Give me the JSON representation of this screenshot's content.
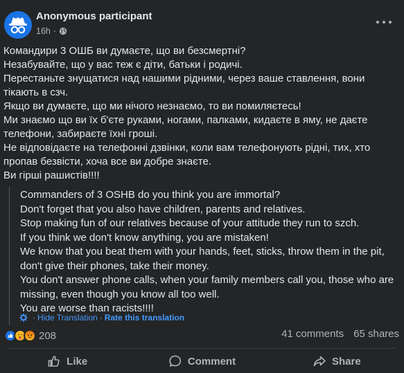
{
  "post": {
    "author": "Anonymous participant",
    "time": "16h",
    "separator": "·",
    "body_lines": [
      "Командири 3 ОШБ ви думаєте, що ви безсмертні?",
      "Незабувайте, що у вас теж є діти, батьки і родичі.",
      "Перестаньте знущатися над нашими рідними, через ваше ставлення, вони",
      "тікають в сзч.",
      "Якщо ви думаєте, що ми нічого незнаємо, то ви помиляєтесь!",
      "Ми знаємо що ви їх б'єте руками, ногами, палками, кидаєте в яму, не даєте",
      "телефони, забираєте їхні гроші.",
      "Не відповідаєте на телефонні дзвінки, коли вам телефонують рідні, тих, хто",
      "пропав безвісти, хоча все ви добре знаєте.",
      "Ви гірші рашистів!!!!"
    ]
  },
  "translation": {
    "lines": [
      "Commanders of 3 OSHB do you think you are immortal?",
      "Don't forget that you also have children, parents and relatives.",
      "Stop making fun of our relatives because of your attitude they run to szch.",
      "If you think we don't know anything, you are mistaken!",
      "We know that you beat them with your hands, feet, sticks, throw them in the pit,",
      "don't give their phones, take their money.",
      "You don't answer phone calls, when your family members call you, those who are",
      "missing, even though you know all too well.",
      "You are worse than racists!!!!"
    ],
    "hide_label": "Hide Translation",
    "separator": "·",
    "rate_label": "Rate this translation"
  },
  "stats": {
    "reaction_count": "208",
    "comments": "41 comments",
    "shares": "65 shares"
  },
  "actions": {
    "like": "Like",
    "comment": "Comment",
    "share": "Share"
  },
  "colors": {
    "card_bg": "#242526",
    "text": "#e4e6eb",
    "muted": "#b0b3b8",
    "link": "#4599ff",
    "like_blue": "#1b74e4",
    "care_yellow": "#f7b928",
    "angry_red": "#e9710f"
  },
  "icons": [
    "incognito-avatar-icon",
    "globe-icon",
    "more-icon",
    "gear-icon",
    "like-reaction-icon",
    "care-reaction-icon",
    "angry-reaction-icon",
    "thumbs-up-icon",
    "comment-icon",
    "share-icon"
  ]
}
